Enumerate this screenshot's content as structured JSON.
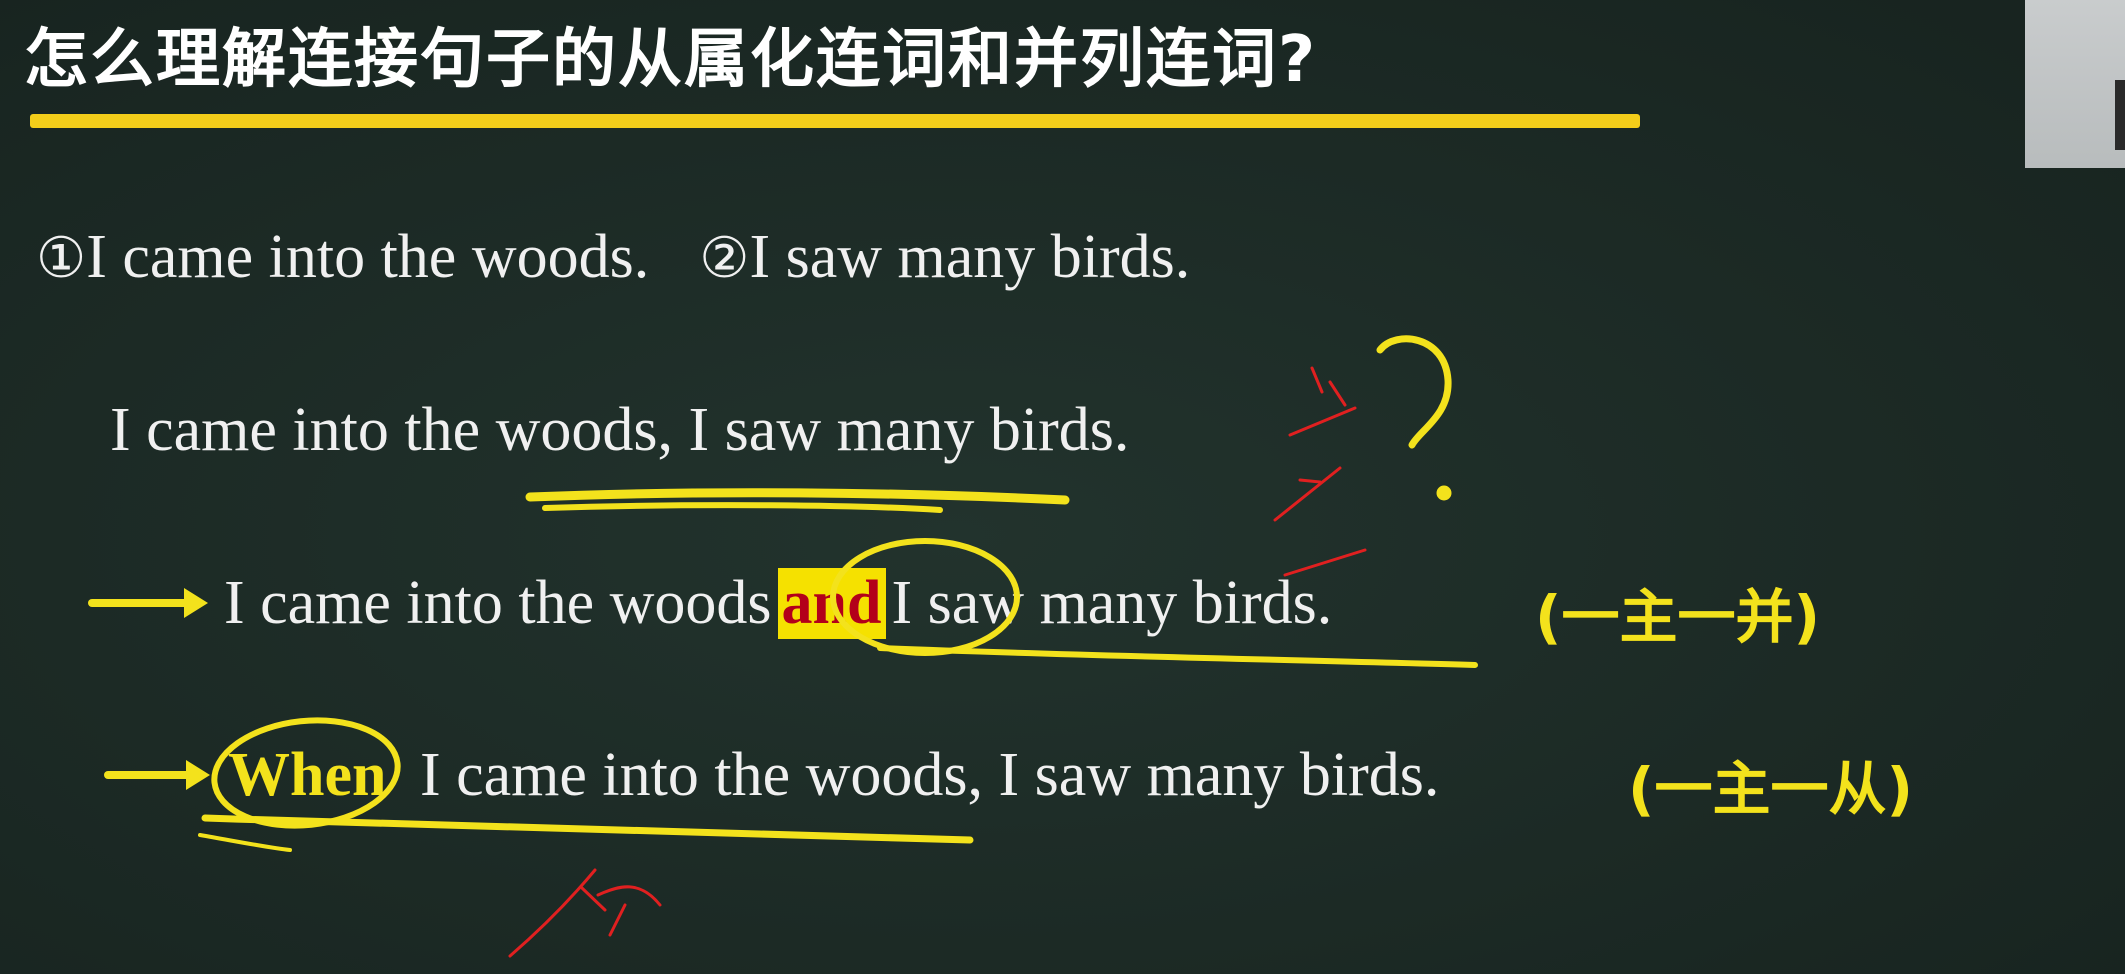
{
  "title": "怎么理解连接句子的从属化连词和并列连词?",
  "sentences": {
    "one_num": "①",
    "one_text": "I came into the woods.",
    "two_num": "②",
    "two_text": "I saw many birds.",
    "combined": "I came into the woods, I saw many birds.",
    "coord_before": "I came into the woods",
    "coord_conj": "and",
    "coord_after": "I saw many birds.",
    "coord_tag": "(一主一并)",
    "subord_conj": "When",
    "subord_rest": "I came into the woods, I saw many birds.",
    "subord_tag": "(一主一从)"
  },
  "colors": {
    "board": "#1d2b26",
    "highlight": "#f3e21c",
    "title_underline": "#f3cd1a",
    "red_ink": "#e02020",
    "conj_text": "#b3001a"
  }
}
